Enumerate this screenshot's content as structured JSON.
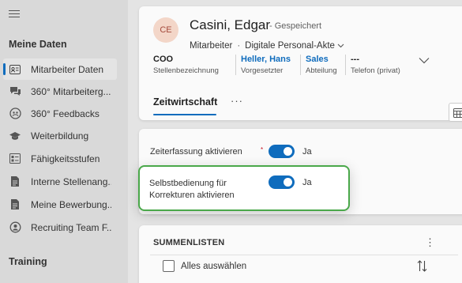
{
  "sidebar": {
    "group1": "Meine Daten",
    "group2": "Training",
    "items": [
      {
        "label": "Mitarbeiter Daten",
        "icon": "contact-card-icon",
        "active": true
      },
      {
        "label": "360° Mitarbeiterg...",
        "icon": "chat-icon",
        "active": false
      },
      {
        "label": "360° Feedbacks",
        "icon": "feedback-icon",
        "active": false
      },
      {
        "label": "Weiterbildung",
        "icon": "graduation-cap-icon",
        "active": false
      },
      {
        "label": "Fähigkeitsstufen",
        "icon": "skill-list-icon",
        "active": false
      },
      {
        "label": "Interne Stellenang...",
        "icon": "document-icon",
        "active": false
      },
      {
        "label": "Meine Bewerbung...",
        "icon": "document-icon",
        "active": false
      },
      {
        "label": "Recruiting Team F...",
        "icon": "recruiting-icon",
        "active": false
      }
    ]
  },
  "header": {
    "avatar_initials": "CE",
    "name": "Casini, Edgar",
    "saved_status": "- Gespeichert",
    "role": "Mitarbeiter",
    "separator": "·",
    "form": "Digitale Personal-Akte",
    "fields": [
      {
        "value": "COO",
        "label": "Stellenbezeichnung",
        "link": false
      },
      {
        "value": "Heller, Hans",
        "label": "Vorgesetzter",
        "link": true
      },
      {
        "value": "Sales",
        "label": "Abteilung",
        "link": true
      },
      {
        "value": "---",
        "label": "Telefon (privat)",
        "link": false
      }
    ],
    "tab_active": "Zeitwirtschaft",
    "more_tabs": "···"
  },
  "settings": {
    "zeiterfassung_label": "Zeiterfassung aktivieren",
    "required_marker": "*",
    "zeiterfassung_value": "Ja",
    "selbstbedienung_label": "Selbstbedienung für Korrekturen aktivieren",
    "selbstbedienung_value": "Ja"
  },
  "list": {
    "title": "SUMMENLISTEN",
    "more": "⋮",
    "select_all": "Alles auswählen"
  },
  "colors": {
    "accent": "#0f6cbd",
    "highlight_border": "#4aa84a",
    "avatar_bg": "#f3d6c8"
  }
}
